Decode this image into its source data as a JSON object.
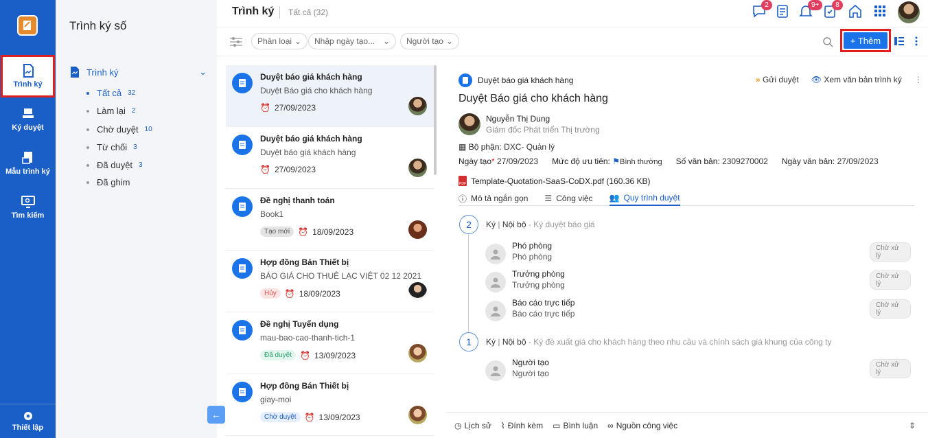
{
  "rail": {
    "items": [
      {
        "label": "Trình ký",
        "icon": "document-sign-icon"
      },
      {
        "label": "Ký duyệt",
        "icon": "stamp-icon"
      },
      {
        "label": "Mẫu trình ký",
        "icon": "template-icon"
      },
      {
        "label": "Tìm kiếm",
        "icon": "monitor-search-icon"
      }
    ],
    "settings": "Thiết lập"
  },
  "nav": {
    "title": "Trình ký số",
    "group": "Trình ký",
    "items": [
      {
        "label": "Tất cả",
        "count": "32"
      },
      {
        "label": "Làm lại",
        "count": "2"
      },
      {
        "label": "Chờ duyệt",
        "count": "10"
      },
      {
        "label": "Từ chối",
        "count": "3"
      },
      {
        "label": "Đã duyệt",
        "count": "3"
      },
      {
        "label": "Đã ghim",
        "count": ""
      }
    ]
  },
  "header": {
    "title": "Trình ký",
    "subtitle": "Tất cả (32)",
    "badges": {
      "chat": "2",
      "notify": "9+",
      "tasks": "8"
    }
  },
  "filters": {
    "classify": "Phân loại",
    "date": "Nhập ngày tạo...",
    "creator": "Người tạo",
    "add": "+ Thêm"
  },
  "list": [
    {
      "title": "Duyệt báo giá khách hàng",
      "desc": "Duyệt Báo giá cho khách hàng",
      "tag": "",
      "date": "27/09/2023"
    },
    {
      "title": "Duyệt báo giá khách hàng",
      "desc": "Duyệt báo giá khách hàng",
      "tag": "",
      "date": "27/09/2023"
    },
    {
      "title": "Đề nghị thanh toán",
      "desc": "Book1",
      "tag": "Tạo mới",
      "date": "18/09/2023"
    },
    {
      "title": "Hợp đồng Bán Thiết bị",
      "desc": "BÁO GIÁ CHO THUÊ LẠC VIỆT 02 12 2021",
      "tag": "Hủy",
      "date": "18/09/2023"
    },
    {
      "title": "Đề nghị Tuyển dụng",
      "desc": "mau-bao-cao-thanh-tich-1",
      "tag": "Đã duyệt",
      "date": "13/09/2023"
    },
    {
      "title": "Hợp đồng Bán Thiết bị",
      "desc": "giay-moi",
      "tag": "Chờ duyệt",
      "date": "13/09/2023"
    }
  ],
  "detail": {
    "category": "Duyệt báo giá khách hàng",
    "send": "Gửi duyệt",
    "view": "Xem văn bản trình ký",
    "title": "Duyệt Báo giá cho khách hàng",
    "person_name": "Nguyễn Thị Dung",
    "person_role": "Giám đốc Phát triển Thị trường",
    "dept_label": "Bộ phận:",
    "dept_value": "DXC- Quản lý",
    "created_label": "Ngày tạo",
    "created_value": "27/09/2023",
    "priority_label": "Mức độ ưu tiên:",
    "priority_value": "Bình thường",
    "doc_no_label": "Số văn bản:",
    "doc_no_value": "2309270002",
    "doc_date_label": "Ngày văn bản:",
    "doc_date_value": "27/09/2023",
    "file": "Template-Quotation-SaaS-CoDX.pdf (160.36 KB)",
    "tabs": [
      "Mô tả ngắn gọn",
      "Công việc",
      "Quy trình duyệt"
    ],
    "steps": [
      {
        "no": "2",
        "type": "Ký",
        "scope": "Nội bộ",
        "desc": "Ký duyệt báo giá",
        "approvers": [
          {
            "name": "Phó phòng",
            "role": "Phó phòng",
            "status": "Chờ xử lý"
          },
          {
            "name": "Trưởng phòng",
            "role": "Trưởng phòng",
            "status": "Chờ xử lý"
          },
          {
            "name": "Báo cáo trực tiếp",
            "role": "Báo cáo trực tiếp",
            "status": "Chờ xử lý"
          }
        ]
      },
      {
        "no": "1",
        "type": "Ký",
        "scope": "Nội bộ",
        "desc": "Ký đề xuất giá cho khách hàng theo nhu cầu và chính sách giá khung của công ty",
        "approvers": [
          {
            "name": "Người tạo",
            "role": "Người tạo",
            "status": "Chờ xử lý"
          }
        ]
      }
    ],
    "footer": [
      "Lịch sử",
      "Đính kèm",
      "Bình luận",
      "Nguồn công việc"
    ]
  }
}
